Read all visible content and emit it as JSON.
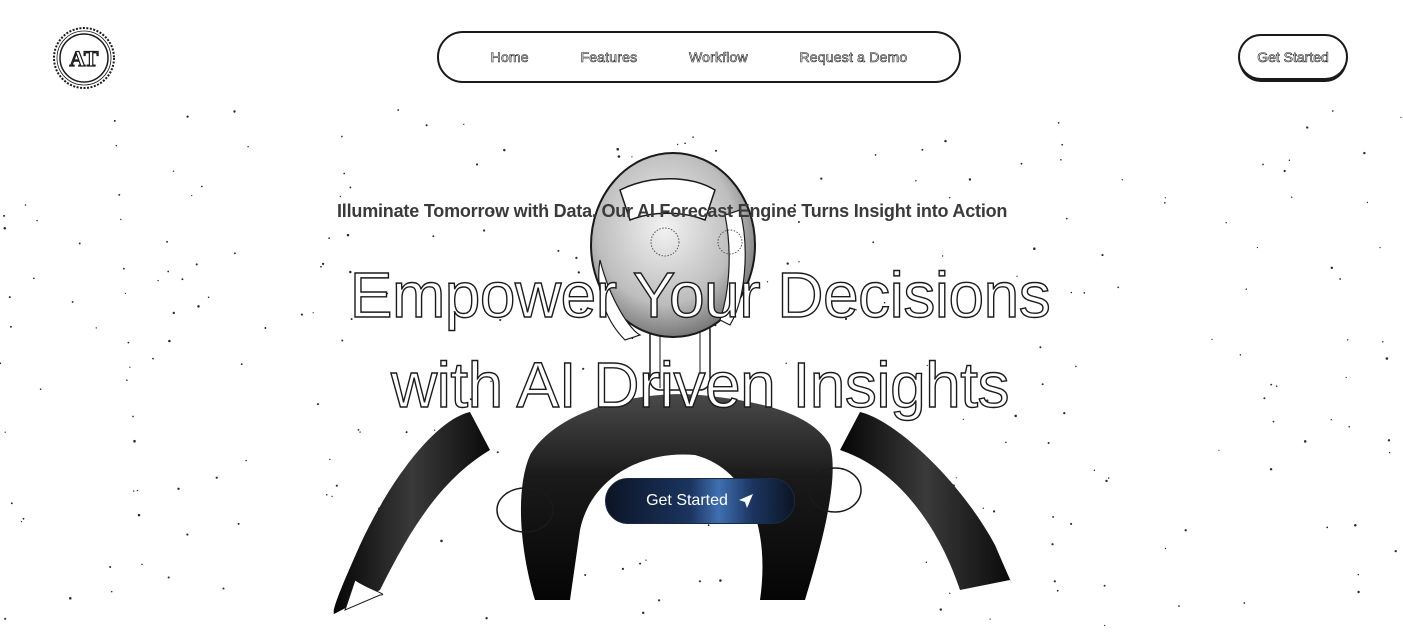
{
  "brand": {
    "logo_text": "AT"
  },
  "nav": {
    "items": [
      {
        "label": "Home"
      },
      {
        "label": "Features"
      },
      {
        "label": "Workflow"
      },
      {
        "label": "Request a Demo"
      }
    ],
    "cta_label": "Get Started"
  },
  "hero": {
    "subtitle": "Illuminate Tomorrow with Data. Our AI Forecast Engine Turns Insight into Action",
    "headline_line1": "Empower Your Decisions",
    "headline_line2": "with AI Driven Insights",
    "cta_label": "Get Started",
    "cta_icon": "send-arrow-icon"
  },
  "colors": {
    "background": "#ffffff",
    "outline": "#1a1a1a",
    "cta_dark": "#0b1424",
    "cta_highlight": "#3f6fb0"
  }
}
